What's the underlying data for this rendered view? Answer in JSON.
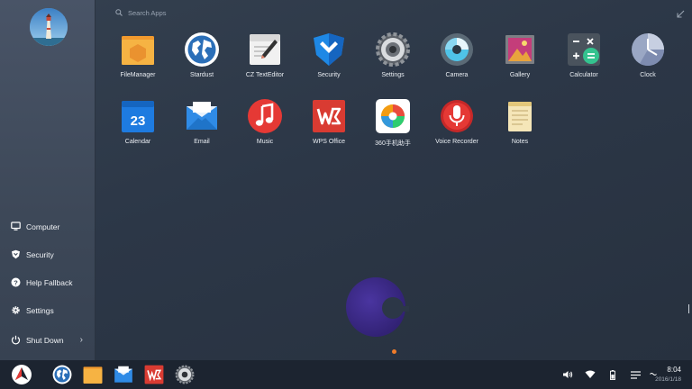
{
  "search": {
    "placeholder": "Search Apps"
  },
  "apps": [
    {
      "label": "FileManager",
      "icon": "folder-icon"
    },
    {
      "label": "Stardust",
      "icon": "globe-icon"
    },
    {
      "label": "CZ TextEditor",
      "icon": "text-editor-icon"
    },
    {
      "label": "Security",
      "icon": "shield-icon"
    },
    {
      "label": "Settings",
      "icon": "gear-icon"
    },
    {
      "label": "Camera",
      "icon": "camera-icon"
    },
    {
      "label": "Gallery",
      "icon": "gallery-icon"
    },
    {
      "label": "Calculator",
      "icon": "calculator-icon"
    },
    {
      "label": "Clock",
      "icon": "clock-icon"
    },
    {
      "label": "Calendar",
      "icon": "calendar-icon",
      "badge": "23"
    },
    {
      "label": "Email",
      "icon": "email-icon"
    },
    {
      "label": "Music",
      "icon": "music-icon"
    },
    {
      "label": "WPS Office",
      "icon": "wps-icon"
    },
    {
      "label": "360手机助手",
      "icon": "360-helper-icon"
    },
    {
      "label": "Voice Recorder",
      "icon": "microphone-icon"
    },
    {
      "label": "Notes",
      "icon": "notes-icon"
    }
  ],
  "sidebar": {
    "items": [
      {
        "label": "Computer",
        "icon": "monitor-icon"
      },
      {
        "label": "Security",
        "icon": "shield-icon"
      },
      {
        "label": "Help Fallback",
        "icon": "help-icon"
      },
      {
        "label": "Settings",
        "icon": "gear-icon"
      },
      {
        "label": "Shut Down",
        "icon": "power-icon"
      }
    ]
  },
  "taskbar": {
    "pinned": [
      "start-logo-icon",
      "stardust-icon",
      "folder-icon",
      "email-icon",
      "wps-icon",
      "gear-icon"
    ],
    "tray": [
      "volume-icon",
      "wifi-icon",
      "battery-icon",
      "notification-icon",
      "input-method-icon"
    ],
    "time": "8:04",
    "date": "2016/1/18"
  },
  "colors": {
    "desktop_bg": "#2c3747",
    "sidebar_bg": "#424d5f",
    "taskbar_bg": "#1c2430",
    "accent_orange": "#f07c2a",
    "loader_purple": "#3d2a8a"
  }
}
